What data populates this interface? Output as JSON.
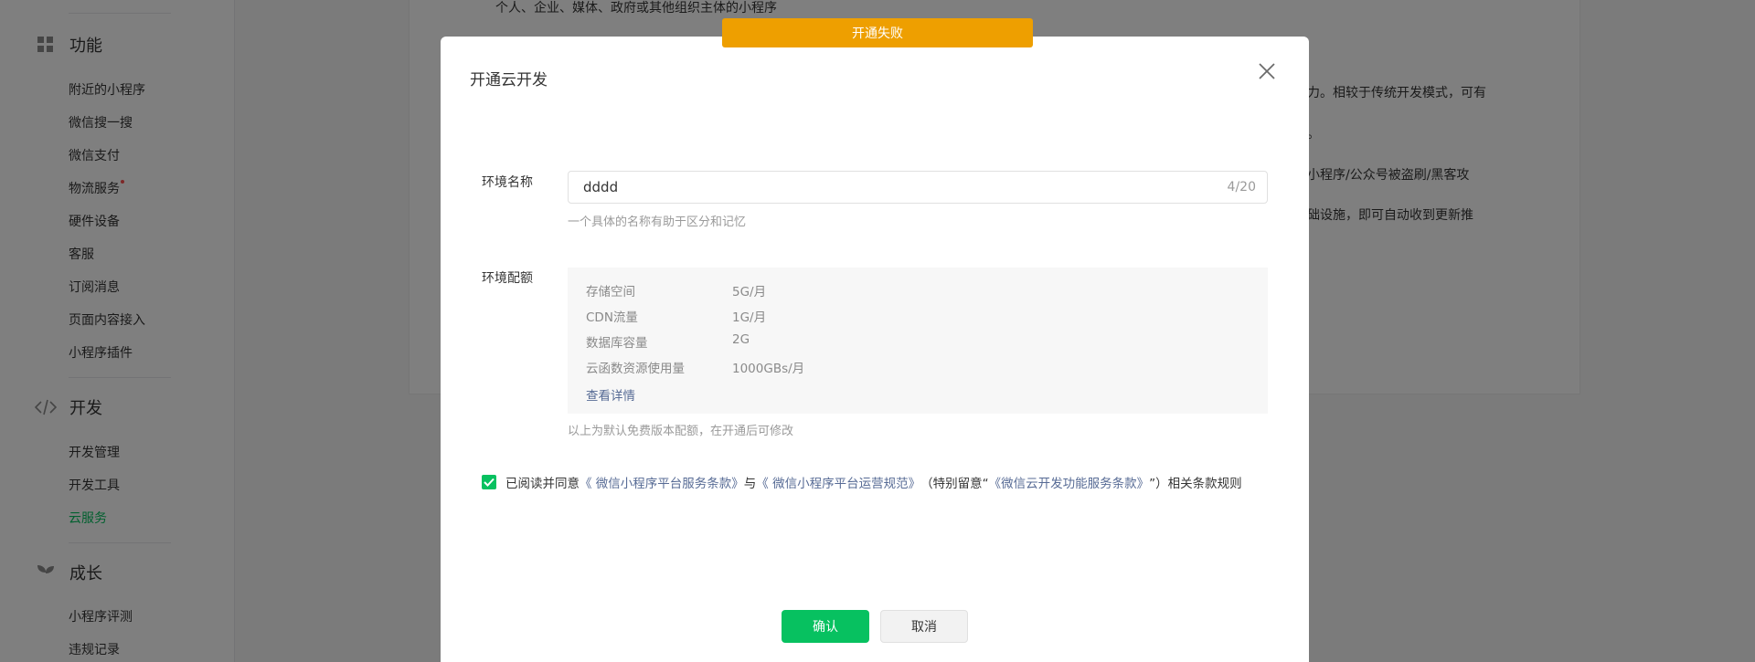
{
  "sidebar": {
    "sections": [
      {
        "title": "功能",
        "icon": "grid-icon",
        "items": [
          "附近的小程序",
          "微信搜一搜",
          "微信支付",
          "物流服务",
          "硬件设备",
          "客服",
          "订阅消息",
          "页面内容接入",
          "小程序插件"
        ]
      },
      {
        "title": "开发",
        "icon": "code-icon",
        "items": [
          "开发管理",
          "开发工具",
          "云服务"
        ]
      },
      {
        "title": "成长",
        "icon": "sprout-icon",
        "items": [
          "小程序评测",
          "违规记录"
        ]
      }
    ],
    "active_item": "云服务"
  },
  "background": {
    "line1": "个人、企业、媒体、政府或其他组织主体的小程序",
    "line2": "力。相较于传统开发模式，可有",
    "line3": "。",
    "line4": "小程序/公众号被盗刷/黑客攻",
    "line5": "础设施，即可自动收到更新推"
  },
  "toast": {
    "text": "开通失败",
    "color": "#ee9f00"
  },
  "dialog": {
    "title": "开通云开发",
    "env_name": {
      "label": "环境名称",
      "value": "dddd",
      "counter": "4/20",
      "hint": "一个具体的名称有助于区分和记忆"
    },
    "quota": {
      "label": "环境配额",
      "rows": [
        {
          "key": "存储空间",
          "value": "5G/月"
        },
        {
          "key": "CDN流量",
          "value": "1G/月"
        },
        {
          "key": "数据库容量",
          "value": "2G"
        },
        {
          "key": "云函数资源使用量",
          "value": "1000GBs/月"
        }
      ],
      "details_link": "查看详情",
      "hint": "以上为默认免费版本配额，在开通后可修改"
    },
    "agreement": {
      "checked": true,
      "prefix": "已阅读并同意",
      "link1": "《 微信小程序平台服务条款》",
      "mid1": "与",
      "link2": "《 微信小程序平台运营规范》",
      "mid2": "（特别留意“",
      "link3": "《微信云开发功能服务条款》",
      "suffix": "”）相关条款规则"
    },
    "confirm_label": "确认",
    "cancel_label": "取消"
  },
  "colors": {
    "accent": "#07c160",
    "link": "#576b95",
    "warning": "#ee9f00"
  }
}
